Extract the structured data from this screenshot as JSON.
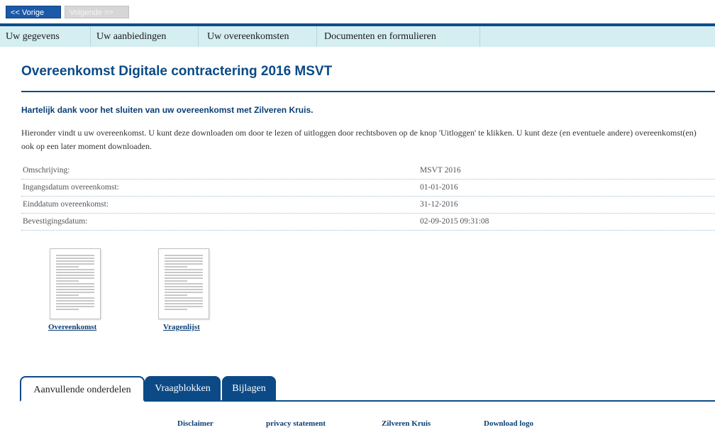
{
  "nav": {
    "prev_label": "<< Vorige",
    "next_label": "Volgende >>"
  },
  "menu": [
    "Uw gegevens",
    "Uw aanbiedingen",
    "Uw overeenkomsten",
    "Documenten en formulieren"
  ],
  "page_title": "Overeenkomst Digitale contractering 2016 MSVT",
  "thanks": "Hartelijk dank voor het sluiten van uw overeenkomst met Zilveren Kruis.",
  "intro": "Hieronder vindt u uw overeenkomst. U kunt deze downloaden om door te lezen of uitloggen door rechtsboven op de knop 'Uitloggen' te klikken. U kunt deze (en eventuele andere) overeenkomst(en) ook op een later moment downloaden.",
  "details": [
    {
      "label": "Omschrijving:",
      "value": "MSVT 2016"
    },
    {
      "label": "Ingangsdatum overeenkomst:",
      "value": "01-01-2016"
    },
    {
      "label": "Einddatum overeenkomst:",
      "value": "31-12-2016"
    },
    {
      "label": "Bevestigingsdatum:",
      "value": "02-09-2015 09:31:08"
    }
  ],
  "documents": [
    {
      "label": "Overeenkomst"
    },
    {
      "label": "Vragenlijst"
    }
  ],
  "tabs": [
    "Aanvullende onderdelen",
    "Vraagblokken",
    "Bijlagen"
  ],
  "footer": [
    "Disclaimer",
    "privacy statement",
    "Zilveren Kruis",
    "Download logo"
  ],
  "colors": {
    "brand_blue": "#0b4a86",
    "menu_bg": "#d4eef1",
    "button_blue": "#1c5aa8"
  }
}
